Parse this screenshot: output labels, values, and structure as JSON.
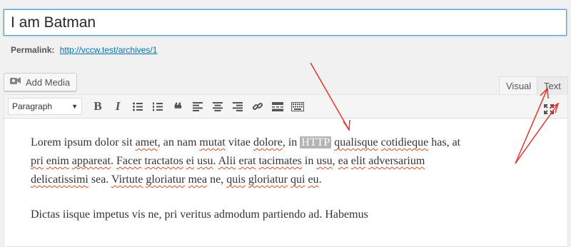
{
  "title": {
    "value": "I am Batman"
  },
  "permalink": {
    "label": "Permalink:",
    "url": "http://vccw.test/archives/1"
  },
  "media": {
    "add_media_label": "Add Media"
  },
  "tabs": {
    "visual": "Visual",
    "text": "Text"
  },
  "toolbar": {
    "format_value": "Paragraph",
    "buttons": [
      "bold",
      "italic",
      "bulleted-list",
      "numbered-list",
      "blockquote",
      "align-left",
      "align-center",
      "align-right",
      "insert-link",
      "read-more",
      "toolbar-toggle",
      "fullscreen"
    ]
  },
  "content": {
    "p1_parts": [
      "Lorem ipsum dolor sit ",
      "amet",
      ", an nam ",
      "mutat",
      " vitae ",
      "dolore",
      ", in ",
      "HTTP",
      " ",
      "qualisque",
      " ",
      "cotidieque",
      " has, at ",
      "pri",
      " ",
      "enim",
      " ",
      "appareat",
      ". ",
      "Facer",
      " ",
      "tractatos",
      " ",
      "ei",
      " ",
      "usu",
      ". ",
      "Alii",
      " ",
      "erat",
      " ",
      "tacimates",
      " in ",
      "usu",
      ", ",
      "ea",
      " ",
      "elit",
      " ",
      "adversarium",
      " ",
      "delicatissimi",
      " sea. ",
      "Virtute",
      " ",
      "gloriatur",
      " ",
      "mea",
      " ne, ",
      "quis",
      " ",
      "gloriatur",
      " ",
      "qui",
      " ",
      "eu",
      "."
    ],
    "p2": "Dictas iisque impetus vis ne, pri veritus admodum partiendo ad. Habemus"
  },
  "colors": {
    "accent": "#0073aa",
    "annotation": "#e8332b",
    "selection": "#b4b4b4"
  }
}
